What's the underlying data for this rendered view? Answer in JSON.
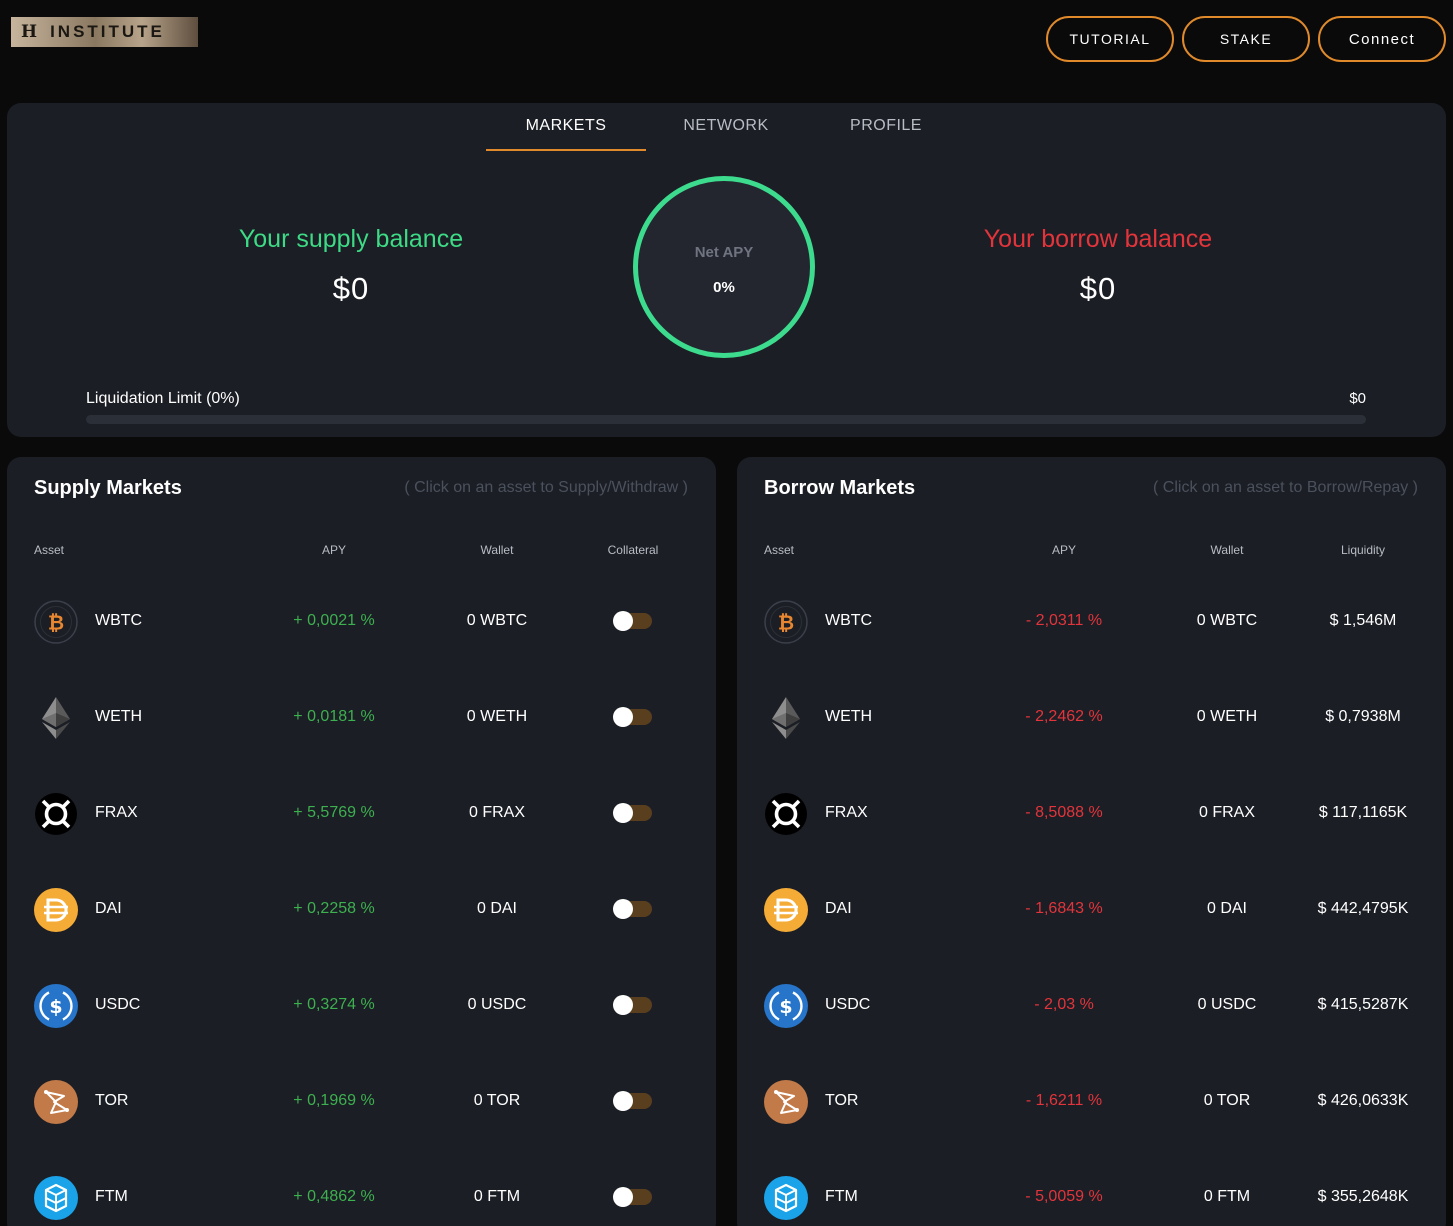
{
  "header": {
    "logo_mark": "H",
    "logo_text": "INSTITUTE",
    "buttons": {
      "tutorial": "TUTORIAL",
      "stake": "STAKE",
      "connect": "Connect"
    },
    "accent_color": "#e08a2c"
  },
  "tabs": [
    {
      "label": "MARKETS",
      "active": true
    },
    {
      "label": "NETWORK",
      "active": false
    },
    {
      "label": "PROFILE",
      "active": false
    }
  ],
  "overview": {
    "supply_title": "Your supply balance",
    "supply_value": "$0",
    "borrow_title": "Your borrow balance",
    "borrow_value": "$0",
    "net_apy_label": "Net APY",
    "net_apy_value": "0%",
    "liquidation_label": "Liquidation Limit (0%)",
    "liquidation_amount": "$0",
    "liquidation_progress": 0,
    "colors": {
      "supply": "#3ddb85",
      "borrow": "#e3343b",
      "ring": "#3ddb8d"
    }
  },
  "supply_markets": {
    "title": "Supply Markets",
    "hint": "( Click on an asset to Supply/Withdraw )",
    "columns": {
      "asset": "Asset",
      "apy": "APY",
      "wallet": "Wallet",
      "collateral": "Collateral"
    },
    "rows": [
      {
        "asset": "WBTC",
        "apy": "+ 0,0021 %",
        "wallet": "0 WBTC",
        "collateral": false,
        "icon": "wbtc-icon"
      },
      {
        "asset": "WETH",
        "apy": "+ 0,0181 %",
        "wallet": "0 WETH",
        "collateral": false,
        "icon": "weth-icon"
      },
      {
        "asset": "FRAX",
        "apy": "+ 5,5769 %",
        "wallet": "0 FRAX",
        "collateral": false,
        "icon": "frax-icon"
      },
      {
        "asset": "DAI",
        "apy": "+ 0,2258 %",
        "wallet": "0 DAI",
        "collateral": false,
        "icon": "dai-icon"
      },
      {
        "asset": "USDC",
        "apy": "+ 0,3274 %",
        "wallet": "0 USDC",
        "collateral": false,
        "icon": "usdc-icon"
      },
      {
        "asset": "TOR",
        "apy": "+ 0,1969 %",
        "wallet": "0 TOR",
        "collateral": false,
        "icon": "tor-icon"
      },
      {
        "asset": "FTM",
        "apy": "+ 0,4862 %",
        "wallet": "0 FTM",
        "collateral": false,
        "icon": "ftm-icon"
      }
    ]
  },
  "borrow_markets": {
    "title": "Borrow Markets",
    "hint": "( Click on an asset to Borrow/Repay )",
    "columns": {
      "asset": "Asset",
      "apy": "APY",
      "wallet": "Wallet",
      "liquidity": "Liquidity"
    },
    "rows": [
      {
        "asset": "WBTC",
        "apy": "- 2,0311 %",
        "wallet": "0 WBTC",
        "liquidity": "$ 1,546M",
        "icon": "wbtc-icon"
      },
      {
        "asset": "WETH",
        "apy": "- 2,2462 %",
        "wallet": "0 WETH",
        "liquidity": "$ 0,7938M",
        "icon": "weth-icon"
      },
      {
        "asset": "FRAX",
        "apy": "- 8,5088 %",
        "wallet": "0 FRAX",
        "liquidity": "$ 117,1165K",
        "icon": "frax-icon"
      },
      {
        "asset": "DAI",
        "apy": "- 1,6843 %",
        "wallet": "0 DAI",
        "liquidity": "$ 442,4795K",
        "icon": "dai-icon"
      },
      {
        "asset": "USDC",
        "apy": "- 2,03 %",
        "wallet": "0 USDC",
        "liquidity": "$ 415,5287K",
        "icon": "usdc-icon"
      },
      {
        "asset": "TOR",
        "apy": "- 1,6211 %",
        "wallet": "0 TOR",
        "liquidity": "$ 426,0633K",
        "icon": "tor-icon"
      },
      {
        "asset": "FTM",
        "apy": "- 5,0059 %",
        "wallet": "0 FTM",
        "liquidity": "$ 355,2648K",
        "icon": "ftm-icon"
      }
    ]
  }
}
